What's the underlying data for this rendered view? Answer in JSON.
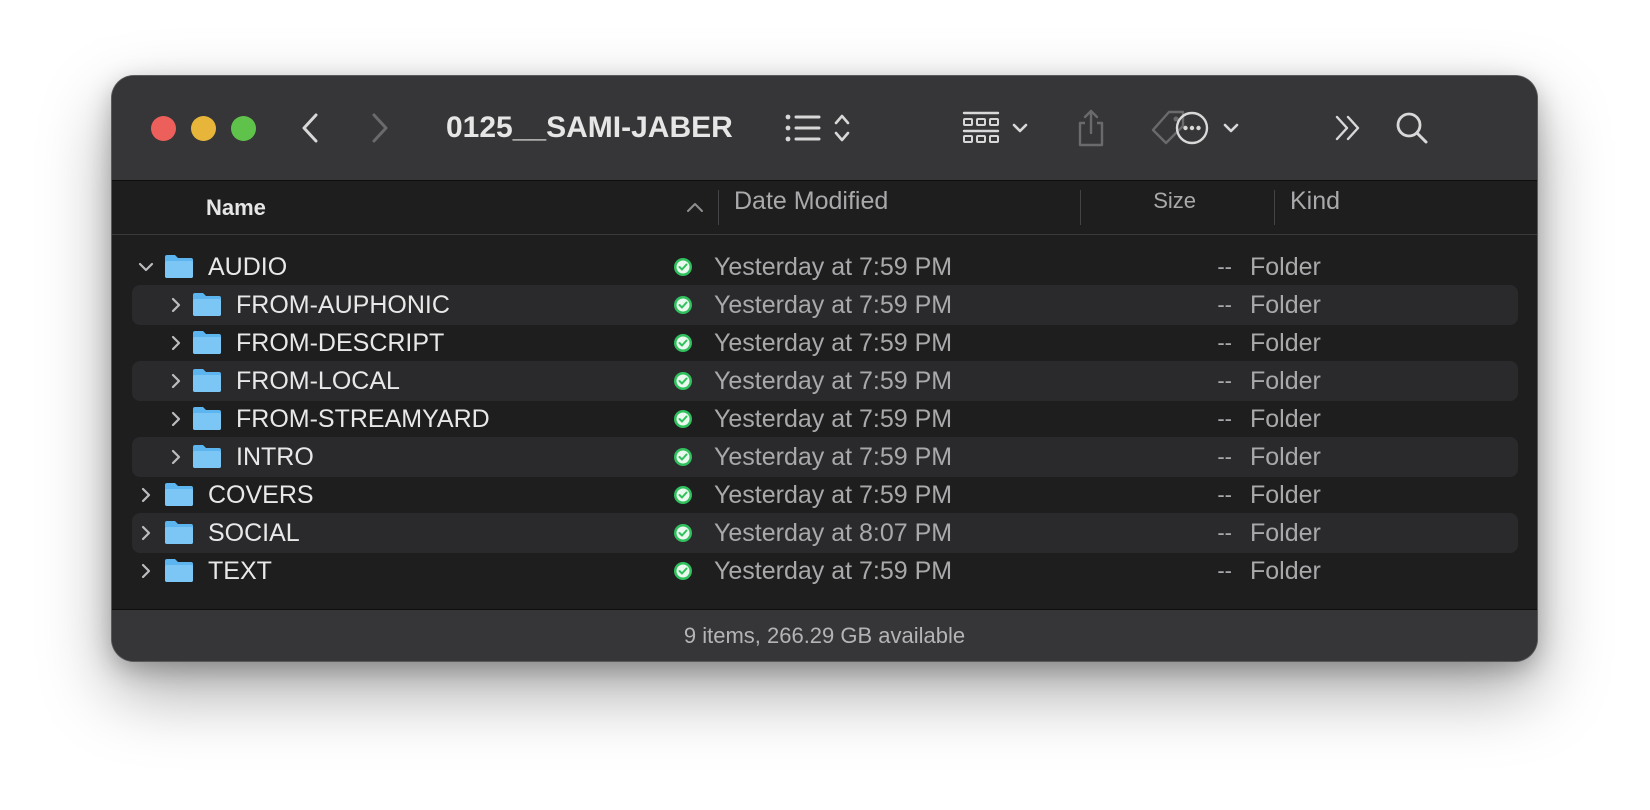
{
  "window": {
    "title": "0125__SAMI-JABER"
  },
  "toolbar": {
    "back_icon": "chevron-left-icon",
    "forward_icon": "chevron-right-icon",
    "view_icon": "list-view-icon",
    "group_icon": "grid-group-icon",
    "share_icon": "share-icon",
    "tag_icon": "tag-icon",
    "action_icon": "ellipsis-circle-icon",
    "more_icon": "double-chevron-right-icon",
    "search_icon": "search-icon"
  },
  "columns": {
    "name": "Name",
    "date": "Date Modified",
    "size": "Size",
    "kind": "Kind"
  },
  "rows": [
    {
      "name": "AUDIO",
      "date": "Yesterday at 7:59 PM",
      "size": "--",
      "kind": "Folder",
      "expanded": true,
      "level": 0
    },
    {
      "name": "FROM-AUPHONIC",
      "date": "Yesterday at 7:59 PM",
      "size": "--",
      "kind": "Folder",
      "expanded": false,
      "level": 1
    },
    {
      "name": "FROM-DESCRIPT",
      "date": "Yesterday at 7:59 PM",
      "size": "--",
      "kind": "Folder",
      "expanded": false,
      "level": 1
    },
    {
      "name": "FROM-LOCAL",
      "date": "Yesterday at 7:59 PM",
      "size": "--",
      "kind": "Folder",
      "expanded": false,
      "level": 1
    },
    {
      "name": "FROM-STREAMYARD",
      "date": "Yesterday at 7:59 PM",
      "size": "--",
      "kind": "Folder",
      "expanded": false,
      "level": 1
    },
    {
      "name": "INTRO",
      "date": "Yesterday at 7:59 PM",
      "size": "--",
      "kind": "Folder",
      "expanded": false,
      "level": 1
    },
    {
      "name": "COVERS",
      "date": "Yesterday at 7:59 PM",
      "size": "--",
      "kind": "Folder",
      "expanded": false,
      "level": 0
    },
    {
      "name": "SOCIAL",
      "date": "Yesterday at 8:07 PM",
      "size": "--",
      "kind": "Folder",
      "expanded": false,
      "level": 0
    },
    {
      "name": "TEXT",
      "date": "Yesterday at 7:59 PM",
      "size": "--",
      "kind": "Folder",
      "expanded": false,
      "level": 0
    }
  ],
  "statusbar": {
    "text": "9 items, 266.29 GB available"
  },
  "colors": {
    "close": "#ec5f5a",
    "minimize": "#e6b53a",
    "maximize": "#5fc24a",
    "folder": "#5db5f0",
    "synced": "#30c15e"
  }
}
